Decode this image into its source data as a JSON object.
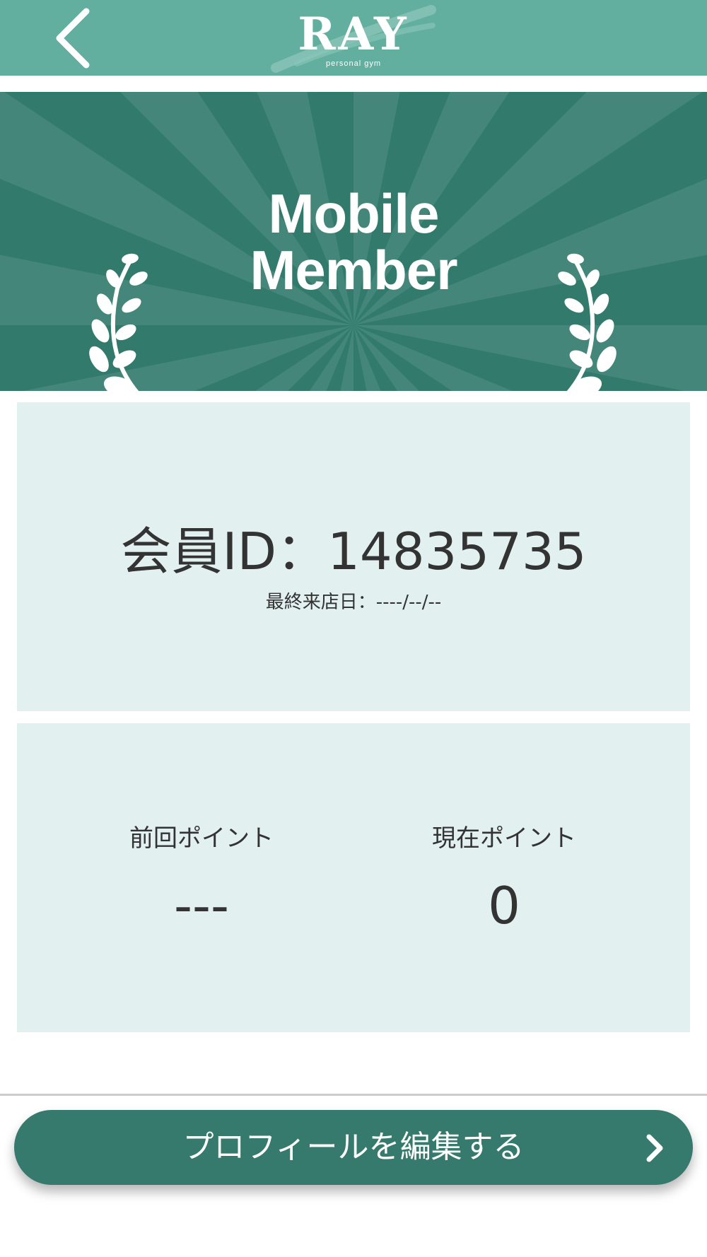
{
  "header": {
    "logo_text": "RAY",
    "logo_sub": "personal gym",
    "back_icon": "chevron-left-icon",
    "background": "#62ae9f"
  },
  "banner": {
    "title_line1": "Mobile",
    "title_line2": "Member",
    "background": "#327a6b",
    "ray_color": "#44877a",
    "icons": [
      "laurel-left-icon",
      "laurel-right-icon"
    ]
  },
  "member": {
    "id_text": "会員ID：14835735",
    "last_visit": "最終来店日：----/--/--",
    "card_color": "#e2f0ef"
  },
  "points": {
    "previous_label": "前回ポイント",
    "previous_value": "---",
    "current_label": "現在ポイント",
    "current_value": "0"
  },
  "profile_button": {
    "label": "プロフィールを編集する",
    "icon": "chevron-right-icon",
    "background": "#357a6c"
  }
}
